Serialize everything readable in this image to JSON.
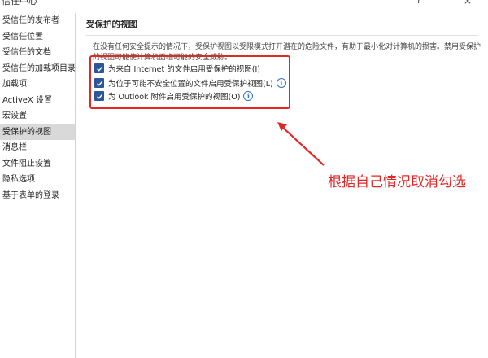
{
  "window": {
    "title": "信任中心",
    "help_glyph": "?",
    "close_glyph": "×"
  },
  "sidebar": {
    "items": [
      {
        "label": "受信任的发布者"
      },
      {
        "label": "受信任位置"
      },
      {
        "label": "受信任的文档"
      },
      {
        "label": "受信任的加载项目录"
      },
      {
        "label": "加载项"
      },
      {
        "label": "ActiveX 设置"
      },
      {
        "label": "宏设置"
      },
      {
        "label": "受保护的视图",
        "selected": true
      },
      {
        "label": "消息栏"
      },
      {
        "label": "文件阻止设置"
      },
      {
        "label": "隐私选项"
      },
      {
        "label": "基于表单的登录"
      }
    ]
  },
  "main": {
    "section_title": "受保护的视图",
    "description": "在没有任何安全提示的情况下，受保护视图以受限模式打开潜在的危险文件，有助于最小化对计算机的损害。禁用受保护的视图可能使计算机面临可能的安全威胁。",
    "options": [
      {
        "label": "为来自 Internet 的文件启用受保护的视图(I)",
        "checked": true,
        "info": false
      },
      {
        "label": "为位于可能不安全位置的文件启用受保护视图(L)",
        "checked": true,
        "info": true
      },
      {
        "label": "为 Outlook 附件启用受保护的视图(O)",
        "checked": true,
        "info": true
      }
    ]
  },
  "annotation": {
    "text": "根据自己情况取消勾选",
    "color": "#e32626"
  },
  "colors": {
    "accent": "#2b579a",
    "selected_bg": "#d9d9d9",
    "annotation_red": "#e32626"
  }
}
